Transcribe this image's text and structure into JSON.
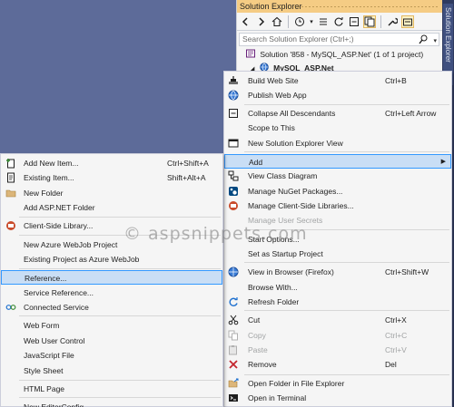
{
  "solution_explorer": {
    "title": "Solution Explorer",
    "side_tab": "Solution Explorer",
    "search_placeholder": "Search Solution Explorer (Ctrl+;)",
    "tree": [
      {
        "label": "Solution '858 - MySQL_ASP.Net' (1 of 1 project)"
      },
      {
        "label": "MySQL_ASP.Net"
      }
    ],
    "colors": {
      "title_bar": "#f5cc84",
      "side_bar": "#2f3a5f",
      "desktop": "#5d6b99"
    }
  },
  "context_menu": {
    "items": [
      {
        "label": "Build Web Site",
        "shortcut": "Ctrl+B",
        "icon": "build-icon"
      },
      {
        "label": "Publish Web App",
        "shortcut": "",
        "icon": "globe-icon"
      },
      {
        "label": "Collapse All Descendants",
        "shortcut": "Ctrl+Left Arrow",
        "icon": "collapse-icon"
      },
      {
        "label": "Scope to This",
        "shortcut": ""
      },
      {
        "label": "New Solution Explorer View",
        "shortcut": "",
        "icon": "new-view-icon"
      },
      {
        "label": "Add",
        "shortcut": "",
        "highlighted": true
      },
      {
        "label": "View Class Diagram",
        "shortcut": "",
        "icon": "class-diagram-icon"
      },
      {
        "label": "Manage NuGet Packages...",
        "shortcut": "",
        "icon": "nuget-icon"
      },
      {
        "label": "Manage Client-Side Libraries...",
        "shortcut": "",
        "icon": "libraries-icon"
      },
      {
        "label": "Manage User Secrets",
        "shortcut": "",
        "disabled": true
      },
      {
        "label": "Start Options...",
        "shortcut": ""
      },
      {
        "label": "Set as Startup Project",
        "shortcut": ""
      },
      {
        "label": "View in Browser (Firefox)",
        "shortcut": "Ctrl+Shift+W",
        "icon": "browser-icon"
      },
      {
        "label": "Browse With...",
        "shortcut": ""
      },
      {
        "label": "Refresh Folder",
        "shortcut": "",
        "icon": "refresh-icon"
      },
      {
        "label": "Cut",
        "shortcut": "Ctrl+X",
        "icon": "scissors-icon"
      },
      {
        "label": "Copy",
        "shortcut": "Ctrl+C",
        "icon": "copy-icon",
        "disabled": true
      },
      {
        "label": "Paste",
        "shortcut": "Ctrl+V",
        "icon": "paste-icon",
        "disabled": true
      },
      {
        "label": "Remove",
        "shortcut": "Del",
        "icon": "remove-icon"
      },
      {
        "label": "Open Folder in File Explorer",
        "shortcut": "",
        "icon": "folder-open-icon"
      },
      {
        "label": "Open in Terminal",
        "shortcut": "",
        "icon": "terminal-icon"
      }
    ]
  },
  "add_submenu": {
    "items": [
      {
        "label": "Add New Item...",
        "shortcut": "Ctrl+Shift+A",
        "icon": "new-item-icon"
      },
      {
        "label": "Existing Item...",
        "shortcut": "Shift+Alt+A",
        "icon": "existing-item-icon"
      },
      {
        "label": "New Folder",
        "shortcut": "",
        "icon": "folder-icon"
      },
      {
        "label": "Add ASP.NET Folder",
        "shortcut": ""
      },
      {
        "label": "Client-Side Library...",
        "shortcut": "",
        "icon": "library-icon"
      },
      {
        "label": "New Azure WebJob Project",
        "shortcut": ""
      },
      {
        "label": "Existing Project as Azure WebJob",
        "shortcut": ""
      },
      {
        "label": "Reference...",
        "shortcut": "",
        "highlighted": true
      },
      {
        "label": "Service Reference...",
        "shortcut": ""
      },
      {
        "label": "Connected Service",
        "shortcut": "",
        "icon": "connected-service-icon"
      },
      {
        "label": "Web Form",
        "shortcut": ""
      },
      {
        "label": "Web User Control",
        "shortcut": ""
      },
      {
        "label": "JavaScript File",
        "shortcut": ""
      },
      {
        "label": "Style Sheet",
        "shortcut": ""
      },
      {
        "label": "HTML Page",
        "shortcut": ""
      },
      {
        "label": "New EditorConfig",
        "shortcut": ""
      }
    ]
  },
  "watermark": "© aspsnippets.com"
}
